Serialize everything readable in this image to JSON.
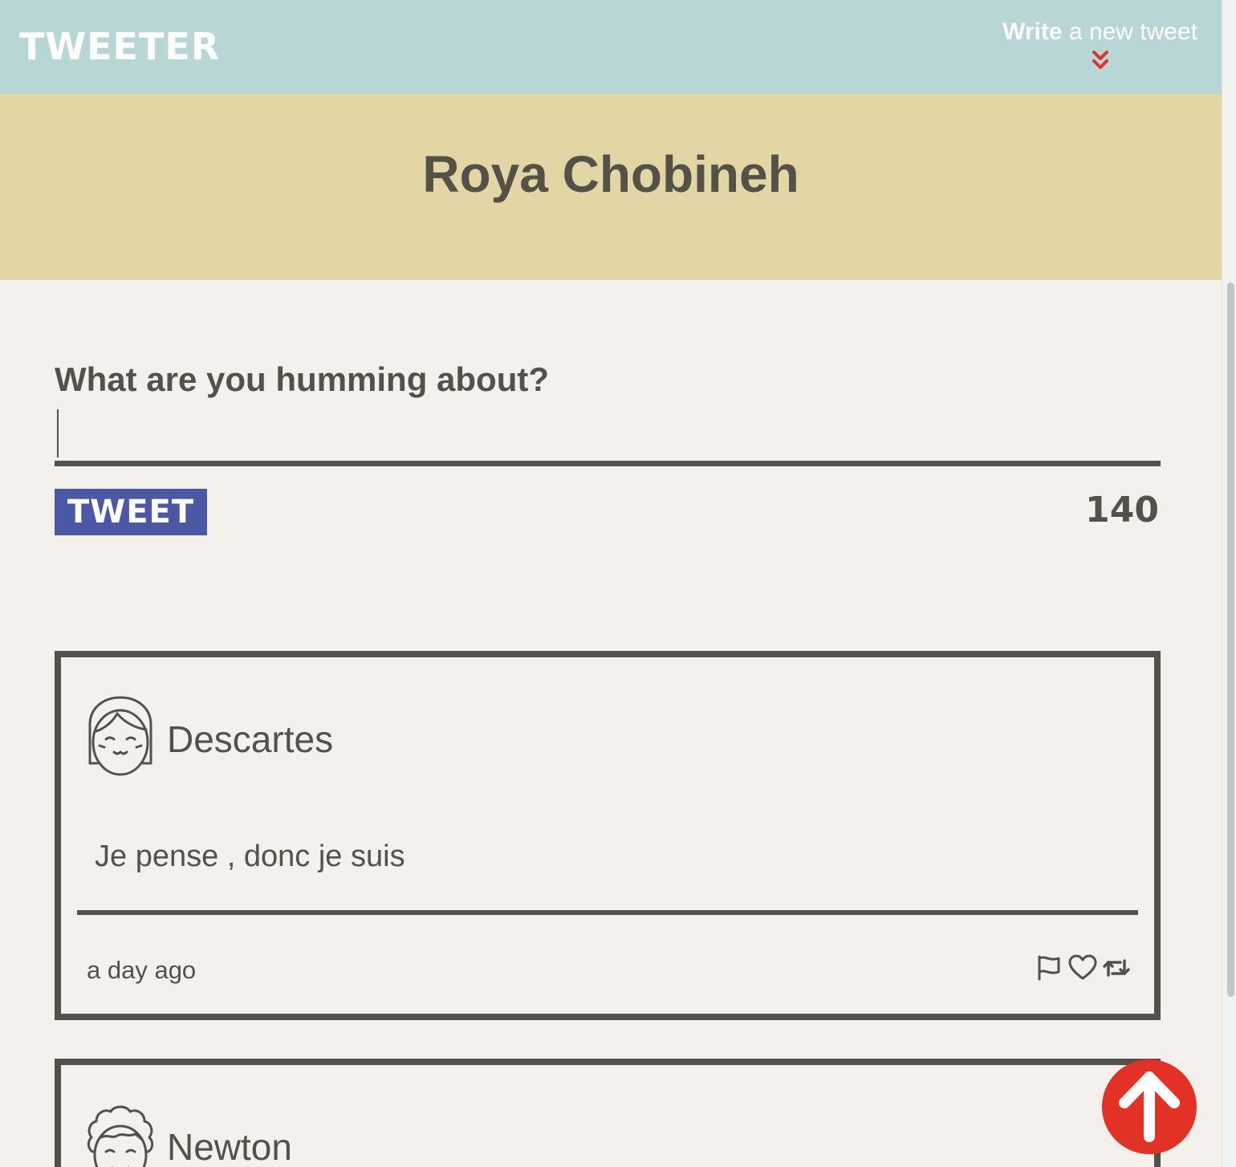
{
  "nav": {
    "brand": "TWEETER",
    "compose_bold": "Write",
    "compose_rest": " a new tweet",
    "chevron_icon": "chevron-double-down-icon",
    "chevron_color": "#e33125"
  },
  "header": {
    "username": "Roya Chobineh"
  },
  "form": {
    "label": "What are you humming about?",
    "input_value": "",
    "button_label": "TWEET",
    "counter": "140"
  },
  "tweets": [
    {
      "handle": "Descartes",
      "avatar_icon": "girl-avatar-icon",
      "content": "Je pense , donc je suis",
      "timestamp": "a day ago",
      "actions": [
        "flag-icon",
        "heart-icon",
        "retweet-icon"
      ]
    },
    {
      "handle": "Newton",
      "avatar_icon": "curly-hair-avatar-icon"
    }
  ],
  "back_to_top": {
    "icon": "arrow-up-icon",
    "color": "#e33125"
  },
  "colors": {
    "nav_bg": "#b8d6d6",
    "header_bg": "#e2d6a4",
    "page_bg": "#f4f1ec",
    "text": "#545149",
    "button_bg": "#4b58a6"
  }
}
